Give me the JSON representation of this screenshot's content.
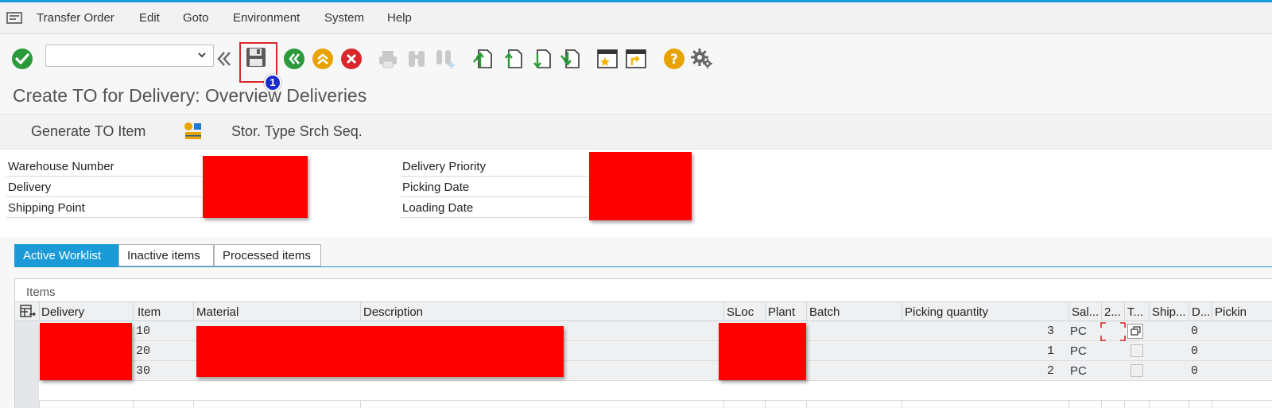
{
  "menubar": {
    "items": [
      {
        "label": "Transfer Order",
        "mnemonic": "T"
      },
      {
        "label": "Edit",
        "mnemonic": "E"
      },
      {
        "label": "Goto",
        "mnemonic": "G"
      },
      {
        "label": "Environment",
        "mnemonic": "v"
      },
      {
        "label": "System",
        "mnemonic": "S"
      },
      {
        "label": "Help",
        "mnemonic": "H"
      }
    ]
  },
  "toolbar": {
    "command_value": "",
    "step_badge": "1"
  },
  "page": {
    "title": "Create TO for Delivery: Overview Deliveries"
  },
  "app_toolbar": {
    "generate_label": "Generate TO Item",
    "search_seq_label": "Stor. Type Srch Seq."
  },
  "header_fields": {
    "warehouse_number": "Warehouse Number",
    "delivery": "Delivery",
    "shipping_point": "Shipping Point",
    "delivery_priority": "Delivery Priority",
    "picking_date": "Picking Date",
    "loading_date": "Loading Date"
  },
  "tabs": {
    "active": "Active Worklist",
    "inactive": "Inactive items",
    "processed": "Processed items"
  },
  "table": {
    "caption": "Items",
    "columns": {
      "delivery": "Delivery",
      "item": "Item",
      "material": "Material",
      "description": "Description",
      "sloc": "SLoc",
      "plant": "Plant",
      "batch": "Batch",
      "picking_qty": "Picking quantity",
      "sales_unit": "Sal...",
      "col2": "2...",
      "colT": "T...",
      "ship": "Ship...",
      "colD": "D...",
      "picking": "Pickin"
    },
    "rows": [
      {
        "item": "10",
        "qty": "3",
        "unit": "PC",
        "d": "0"
      },
      {
        "item": "20",
        "qty": "1",
        "unit": "PC",
        "d": "0"
      },
      {
        "item": "30",
        "qty": "2",
        "unit": "PC",
        "d": "0"
      }
    ]
  },
  "colors": {
    "accent": "#1a9ad6",
    "highlight": "#d9262b",
    "redaction": "#ff0000",
    "badge": "#1b2ccf"
  }
}
